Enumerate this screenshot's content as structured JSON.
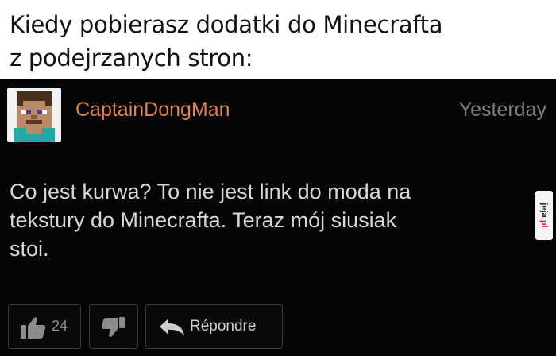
{
  "caption": {
    "line1": "Kiedy pobierasz dodatki do Minecrafta",
    "line2": "z podejrzanych stron:"
  },
  "comment": {
    "author": "CaptainDongMan",
    "timestamp": "Yesterday",
    "body_lines": [
      "Co jest kurwa? To nie jest link do moda na",
      "tekstury do Minecrafta. Teraz mój siusiak",
      "stoi."
    ],
    "avatar_icon": "minecraft-steve-avatar",
    "username_color": "#d9835d",
    "like_count": "24",
    "like_icon": "thumbs-up-icon",
    "dislike_icon": "thumbs-down-icon",
    "reply_icon": "reply-arrow-icon",
    "reply_label": "Répondre"
  },
  "watermark": {
    "brand": "jeja",
    "tld": ".pl"
  }
}
